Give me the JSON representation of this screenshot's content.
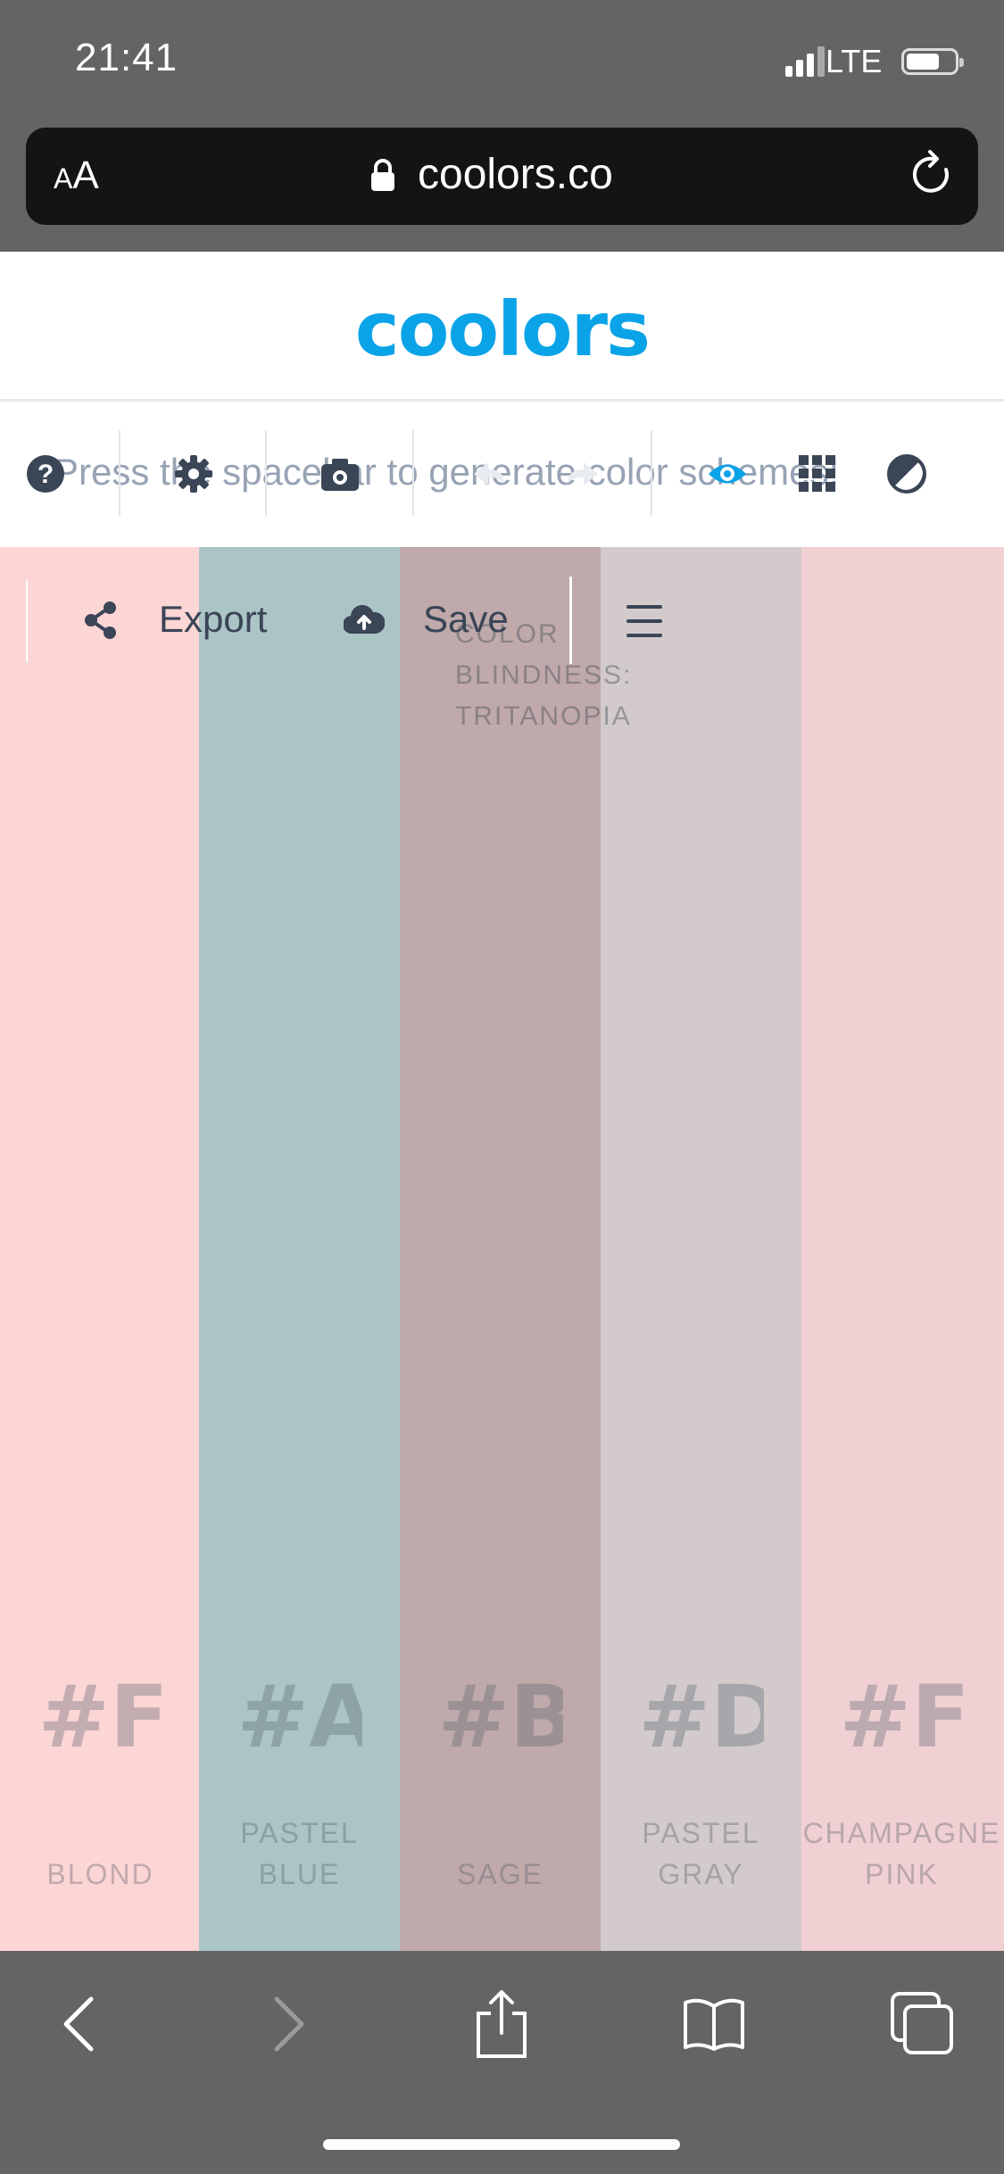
{
  "status": {
    "time": "21:41",
    "network": "LTE"
  },
  "browser": {
    "text_size_label_small": "A",
    "text_size_label_large": "A",
    "url": "coolors.co"
  },
  "header": {
    "logo": "coolors"
  },
  "toolbar": {
    "hint": "Press the spacebar to generate color schemes!"
  },
  "actions": {
    "export_label": "Export",
    "save_label": "Save"
  },
  "color_blindness": {
    "line1": "COLOR",
    "line2": "BLINDNESS:",
    "line3": "TRITANOPIA"
  },
  "palette": [
    {
      "hex": "#F",
      "name_line1": "",
      "name_line2": "BLOND",
      "color": "#fcd5d5"
    },
    {
      "hex": "#A",
      "name_line1": "PASTEL",
      "name_line2": "BLUE",
      "color": "#abc5c6"
    },
    {
      "hex": "#B",
      "name_line1": "",
      "name_line2": "SAGE",
      "color": "#bfa9ab"
    },
    {
      "hex": "#D",
      "name_line1": "PASTEL",
      "name_line2": "GRAY",
      "color": "#d2cacb"
    },
    {
      "hex": "#F",
      "name_line1": "CHAMPAGNE",
      "name_line2": "PINK",
      "color": "#f0d0d3"
    }
  ],
  "icons": [
    "help-icon",
    "settings-icon",
    "camera-icon",
    "undo-icon",
    "redo-icon",
    "eye-icon",
    "grid-icon",
    "contrast-icon",
    "share-icon",
    "cloud-upload-icon",
    "menu-icon",
    "back-icon",
    "forward-icon",
    "share-sheet-icon",
    "bookmarks-icon",
    "tabs-icon",
    "lock-icon",
    "reload-icon"
  ],
  "colors": {
    "accent": "#0aa3e8",
    "chrome": "#646464",
    "urlbar": "#141414",
    "text_dark": "#3a4556"
  }
}
